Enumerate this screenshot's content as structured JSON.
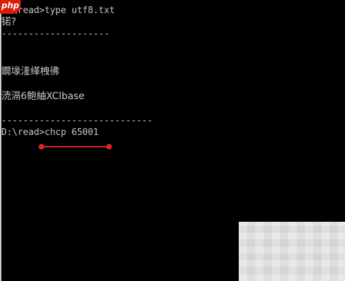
{
  "console": {
    "lines": [
      "D:\\read>type utf8.txt",
      "锘?",
      "--------------------",
      "鐗堟湰缂栧彿",
      "涜滆6鲍紬XClbase",
      "----------------------------",
      "D:\\read>chcp 65001"
    ]
  },
  "watermark": {
    "text": "php"
  },
  "colors": {
    "background": "#000000",
    "text": "#c8c8c8",
    "annotation": "#e0242b",
    "watermark": "#d81e06"
  }
}
